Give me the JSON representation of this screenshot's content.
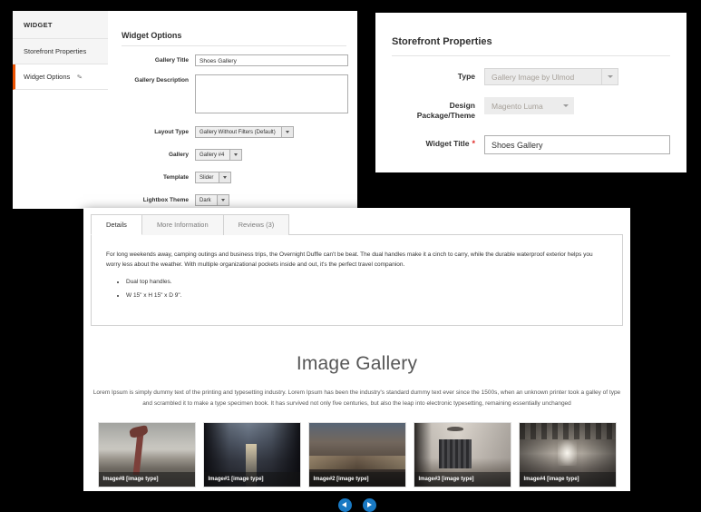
{
  "widget_admin": {
    "sidebar": {
      "heading": "WIDGET",
      "items": [
        {
          "label": "Storefront Properties",
          "active": false
        },
        {
          "label": "Widget Options",
          "active": true
        }
      ],
      "edit_icon": "✎"
    },
    "form": {
      "title": "Widget Options",
      "fields": {
        "gallery_title": {
          "label": "Gallery Title",
          "value": "Shoes Gallery"
        },
        "gallery_description": {
          "label": "Gallery Description",
          "value": ""
        },
        "layout_type": {
          "label": "Layout Type",
          "value": "Gallery Without Filters (Default)"
        },
        "gallery": {
          "label": "Gallery",
          "value": "Gallery #4"
        },
        "template": {
          "label": "Template",
          "value": "Slider"
        },
        "lightbox_theme": {
          "label": "Lightbox Theme",
          "value": "Dark"
        }
      }
    }
  },
  "storefront_properties": {
    "title": "Storefront Properties",
    "fields": {
      "type": {
        "label": "Type",
        "value": "Gallery Image by Ulmod"
      },
      "design_package": {
        "label": "Design Package/Theme",
        "value": "Magento Luma"
      },
      "widget_title": {
        "label": "Widget Title",
        "required_marker": "*",
        "value": "Shoes Gallery"
      }
    }
  },
  "preview": {
    "tabs": [
      {
        "label": "Details",
        "active": true
      },
      {
        "label": "More Information",
        "active": false
      },
      {
        "label": "Reviews (3)",
        "active": false
      }
    ],
    "details": {
      "paragraph": "For long weekends away, camping outings and business trips, the Overnight Duffle can't be beat. The dual handles make it a cinch to carry, while the durable waterproof exterior helps you worry less about the weather. With multiple organizational pockets inside and out, it's the perfect travel companion.",
      "bullets": [
        "Dual top handles.",
        "W 15\" x H 15\" x D 9\"."
      ]
    },
    "gallery": {
      "heading": "Image Gallery",
      "lede": "Lorem Ipsum is simply dummy text of the printing and typesetting industry. Lorem Ipsum has been the industry's standard dummy text ever since the 1500s, when an unknown printer took a galley of type and scrambled it to make a type specimen book. It has survived not only five centuries, but also the leap into electronic typesetting, remaining essentially unchanged",
      "thumbnails": [
        {
          "caption": "Image#8 [image type]",
          "art": "art-fashion"
        },
        {
          "caption": "Image#1 [image type]",
          "art": "art-city-night"
        },
        {
          "caption": "Image#2 [image type]",
          "art": "art-city-dusk"
        },
        {
          "caption": "Image#3 [image type]",
          "art": "art-store"
        },
        {
          "caption": "Image#4 [image type]",
          "art": "art-tunnel"
        }
      ],
      "nav": {
        "prev_label": "‹",
        "next_label": "›"
      }
    }
  },
  "colors": {
    "page_background": "#000000",
    "accent_orange": "#eb5202",
    "accent_blue": "#1979c3",
    "required_red": "#e02b27",
    "text_dark": "#303030",
    "text_muted": "#a6a099"
  }
}
